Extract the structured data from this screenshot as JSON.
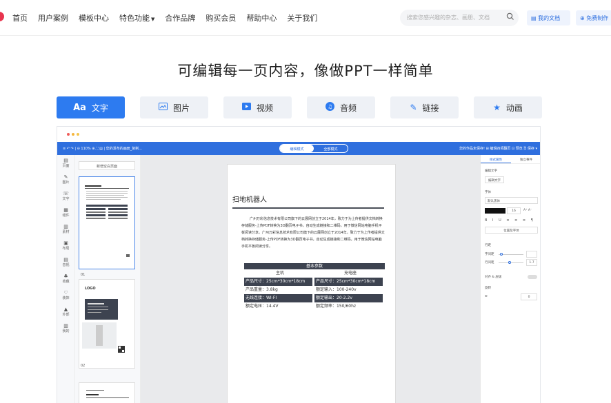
{
  "nav": {
    "items": [
      "首页",
      "用户案例",
      "模板中心",
      "特色功能",
      "合作品牌",
      "购买会员",
      "帮助中心",
      "关于我们"
    ],
    "search_placeholder": "搜索您感兴趣的杂志、画册、文档",
    "my_docs": "我的文档",
    "free_make": "免费制作"
  },
  "heading": "可编辑每一页内容，像做PPT一样简单",
  "tabs": [
    {
      "icon": "Aa",
      "label": "文字"
    },
    {
      "icon": "▣",
      "label": "图片"
    },
    {
      "icon": "▶",
      "label": "视频"
    },
    {
      "icon": "♫",
      "label": "音频"
    },
    {
      "icon": "✎",
      "label": "链接"
    },
    {
      "icon": "★",
      "label": "动画"
    }
  ],
  "editor": {
    "toolbar_left": "≡   ↶ ↷  |  ⊖  110%  ⊕  ⛶  ▤  |  您的发布的画册_复制...",
    "mode_edit": "编辑模式",
    "mode_preview": "全部模式",
    "toolbar_right": "您的作品未保存!   ⊞ 编辑四项翻页   ⊡ 预览   🗎 保存 ▾",
    "rail": [
      "页面",
      "图片",
      "文字",
      "组件",
      "素材",
      "布局",
      "音视",
      "收藏",
      "装饰",
      "外部",
      "我的"
    ],
    "add_page": "新增空白页面",
    "thumb_nums": [
      "01",
      "02"
    ],
    "doc_title": "扫地机器人",
    "doc_paragraphs": [
      "广州万彩信息技术有限公司旗下的云展网创立于2014年，致力于为上传者提供文档转换存储服务-上传PDF转换为3D翻页电子书，自动生成链接和二维码，用于微信网站电脑手机平板阅读分享。广州万彩信息技术有限公司旗下的云展网创立于2014年，致力于为上传者提供文档转换存储服务-上传PDF转换为3D翻页电子书，自动生成链接和二维码，用于微信网站电脑手机平板阅读分享。"
    ],
    "table_header": "基本参数",
    "table_sub": [
      "主机",
      "充电座"
    ],
    "table_rows": [
      [
        "产品尺寸：25cm*30cm*18cm",
        "产品尺寸：25cm*30cm*18cm"
      ],
      [
        "产品重量：3.8kg",
        "额定输入：100-240v"
      ],
      [
        "无线连接：WI-FI",
        "额定输出：20-2.2v"
      ],
      [
        "额定电压：14.4V",
        "额定频率：150/60hz"
      ]
    ],
    "right_tabs": [
      "样式属性",
      "独立事件"
    ],
    "right_labels": [
      "编辑文字",
      "编辑文字",
      "字体",
      "默认黑体",
      "位置及字体",
      "行距",
      "字间距",
      "行间距",
      "对齐 & 层级",
      "旋转"
    ],
    "font_size": "16",
    "line_spacing": "1.7",
    "rotate": "0"
  },
  "colors": {
    "accent": "#2d7bf0",
    "toolbar": "#2f6fde",
    "logo": "#e8344e"
  }
}
